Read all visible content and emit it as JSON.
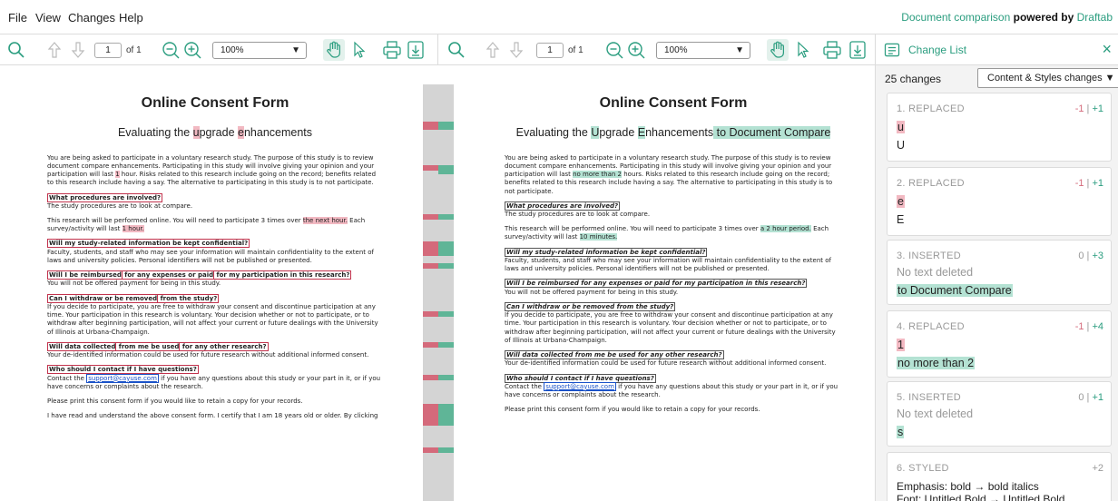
{
  "menu": {
    "items": [
      "File",
      "View",
      "Changes",
      "Help"
    ]
  },
  "branding": {
    "text": "Document comparison",
    "powered": "powered by",
    "brand": "Draftab"
  },
  "toolbar": {
    "page": "1",
    "of": "of 1",
    "zoom": "100%"
  },
  "left_doc": {
    "title": "Online Consent Form",
    "subtitle_a": "Evaluating the ",
    "subtitle_b": "u",
    "subtitle_c": "pgrade ",
    "subtitle_d": "e",
    "subtitle_e": "nhancements",
    "intro": "You are being asked to participate in a voluntary research study. The purpose of this study is to review document compare enhancements. Participating in this study will involve giving your opinion and your participation will last ",
    "intro_del": "1",
    "intro_end": " hour. Risks related to this research include going on the record; benefits related to this research include having a say. The alternative to participating in this study is to not participate.",
    "q1": "What procedures are involved?",
    "a1": "The study procedures are to look at compare.",
    "p2a": "This research will be performed online. You will need to participate 3 times over ",
    "p2_del": "the next hour.",
    "p2b": " Each survey/activity will last ",
    "p2_del2": "1 hour.",
    "q2": "Will my study-related information be kept confidential?",
    "a2": "Faculty, students, and staff who may see your information will maintain confidentiality to the extent of laws and university policies. Personal identifiers will not be published or presented.",
    "q3a": "Will I be reimbursed",
    "q3b": " for any expenses or paid",
    "q3c": " for my participation in this research?",
    "a3": "You will not be offered payment for being in this study.",
    "q4a": "Can I withdraw or be removed",
    "q4b": " from the study?",
    "a4": "If you decide to participate, you are free to withdraw your consent and discontinue participation at any time. Your participation in this research is voluntary. Your decision whether or not to participate, or to withdraw after beginning participation, will not affect your current or future dealings with the University of Illinois at Urbana-Champaign.",
    "q5a": "Will data collected",
    "q5b": " from me be used",
    "q5c": " for any other research?",
    "a5": "Your de-identified information could be used for future research without additional informed consent.",
    "q6": "Who should I contact if I have questions?",
    "a6a": "Contact the ",
    "a6_link": "support@cayuse.com",
    "a6b": " if you have any questions about this study or your part in it, or if you have concerns or complaints about the research.",
    "p7": "Please print this consent form if you would like to retain a copy for your records.",
    "p8": "I have read and understand the above consent form. I certify that I am 18 years old or older. By clicking"
  },
  "right_doc": {
    "title": "Online Consent Form",
    "subtitle_a": "Evaluating the ",
    "subtitle_b": "U",
    "subtitle_c": "pgrade ",
    "subtitle_d": "E",
    "subtitle_e": "nhancements",
    "subtitle_ins": " to Document Compare",
    "intro": "You are being asked to participate in a voluntary research study. The purpose of this study is to review document compare enhancements. Participating in this study will involve giving your opinion and your participation will last ",
    "intro_ins": "no more than 2",
    "intro_end": " hours. Risks related to this research include going on the record; benefits related to this research include having a say. The alternative to participating in this study is to not participate.",
    "q1": "What procedures are involved?",
    "a1": "The study procedures are to look at compare.",
    "p2a": "This research will be performed online. You will need to participate 3 times over ",
    "p2_ins": "a 2 hour period.",
    "p2b": " Each survey/activity will last ",
    "p2_ins2": "10 minutes.",
    "q2": "Will my study-related information be kept confidential?",
    "a2": "Faculty, students, and staff who may see your information will maintain confidentiality to the extent of laws and university policies. Personal identifiers will not be published or presented.",
    "q3": "Will I be reimbursed for any expenses or paid for my participation in this research?",
    "a3": "You will not be offered payment for being in this study.",
    "q4": "Can I withdraw or be removed from the study?",
    "a4": "If you decide to participate, you are free to withdraw your consent and discontinue participation at any time. Your participation in this research is voluntary. Your decision whether or not to participate, or to withdraw after beginning participation, will not affect your current or future dealings with the University of Illinois at Urbana-Champaign.",
    "q5": "Will data collected from me be used for any other research?",
    "a5": "Your de-identified information could be used for future research without additional informed consent.",
    "q6": "Who should I contact if I have questions?",
    "a6a": "Contact the ",
    "a6_link": "support@cayuse.com",
    "a6b": " if you have any questions about this study or your part in it, or if you have concerns or complaints about the research.",
    "p7": "Please print this consent form if you would like to retain a copy for your records."
  },
  "panel": {
    "title": "Change List",
    "count": "25 changes",
    "filter": "Content & Styles changes",
    "cards": [
      {
        "type": "1. REPLACED",
        "minus": "-1",
        "sep": "|",
        "plus": "+1",
        "old": "u",
        "new": "U"
      },
      {
        "type": "2. REPLACED",
        "minus": "-1",
        "sep": "|",
        "plus": "+1",
        "old": "e",
        "new": "E"
      },
      {
        "type": "3. INSERTED",
        "minus": "0",
        "sep": "|",
        "plus": "+3",
        "old": "No text deleted",
        "new": "to Document Compare"
      },
      {
        "type": "4. REPLACED",
        "minus": "-1",
        "sep": "|",
        "plus": "+4",
        "old": "1",
        "new": "no more than 2"
      },
      {
        "type": "5. INSERTED",
        "minus": "0",
        "sep": "|",
        "plus": "+1",
        "old": "No text deleted",
        "new": "s"
      },
      {
        "type": "6. STYLED",
        "plus": "+2",
        "line1": "Emphasis: bold → bold italics",
        "line2": "Font: Untitled Bold → Untitled Bold"
      }
    ]
  },
  "colors": {
    "accent": "#2a9d7f",
    "deleted": "#f2b9c2",
    "inserted": "#b4e2d3",
    "delete_marker": "#d46a7b",
    "insert_marker": "#5fb597"
  }
}
